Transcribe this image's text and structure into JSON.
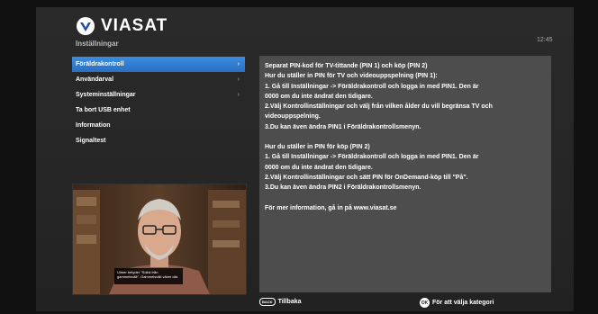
{
  "brand": {
    "name": "VIASAT"
  },
  "header": {
    "section_title": "Inställningar",
    "clock": "12:45"
  },
  "menu": {
    "items": [
      {
        "label": "Föräldrakontroll",
        "has_submenu": true,
        "selected": true
      },
      {
        "label": "Användarval",
        "has_submenu": true,
        "selected": false
      },
      {
        "label": "Systeminställningar",
        "has_submenu": true,
        "selected": false
      },
      {
        "label": "Ta bort USB enhet",
        "has_submenu": false,
        "selected": false
      },
      {
        "label": "Information",
        "has_submenu": false,
        "selected": false
      },
      {
        "label": "Signaltest",
        "has_submenu": false,
        "selected": false
      }
    ]
  },
  "video": {
    "caption": "Ulmer betyder \"Solist från gammelsvält\". Gammelsvält växer där."
  },
  "info": {
    "lines": [
      "Separat PIN-kod för TV-tittande (PIN 1) och köp (PIN 2)",
      "Hur du ställer in PIN för TV och videouppspelning (PIN 1):",
      "1. Gå till Inställningar -> Föräldrakontroll och logga in med PIN1. Den är",
      "0000 om du inte ändrat den tidigare.",
      "2.Välj Kontrollinställningar och välj från vilken ålder du vill begränsa TV och",
      "videouppspelning.",
      "3.Du kan även ändra PIN1 i Föräldrakontrollsmenyn.",
      "",
      "Hur du ställer in PIN för köp (PIN 2)",
      "1. Gå till Inställningar -> Föräldrakontroll och logga in med PIN1. Den är",
      "0000 om du inte ändrat den tidigare.",
      "2.Välj Kontrollinställningar och sätt PIN för OnDemand-köp till \"På\".",
      "3.Du kan även ändra PIN2 i Föräldrakontrollsmenyn.",
      "",
      "För mer information, gå in på www.viasat.se"
    ]
  },
  "footer": {
    "back_key": "BACK",
    "back_label": "Tillbaka",
    "ok_key": "OK",
    "ok_label": "För att välja kategori"
  },
  "colors": {
    "accent": "#2f7ed8",
    "panel": "#4d4d4d",
    "background": "#262626"
  }
}
